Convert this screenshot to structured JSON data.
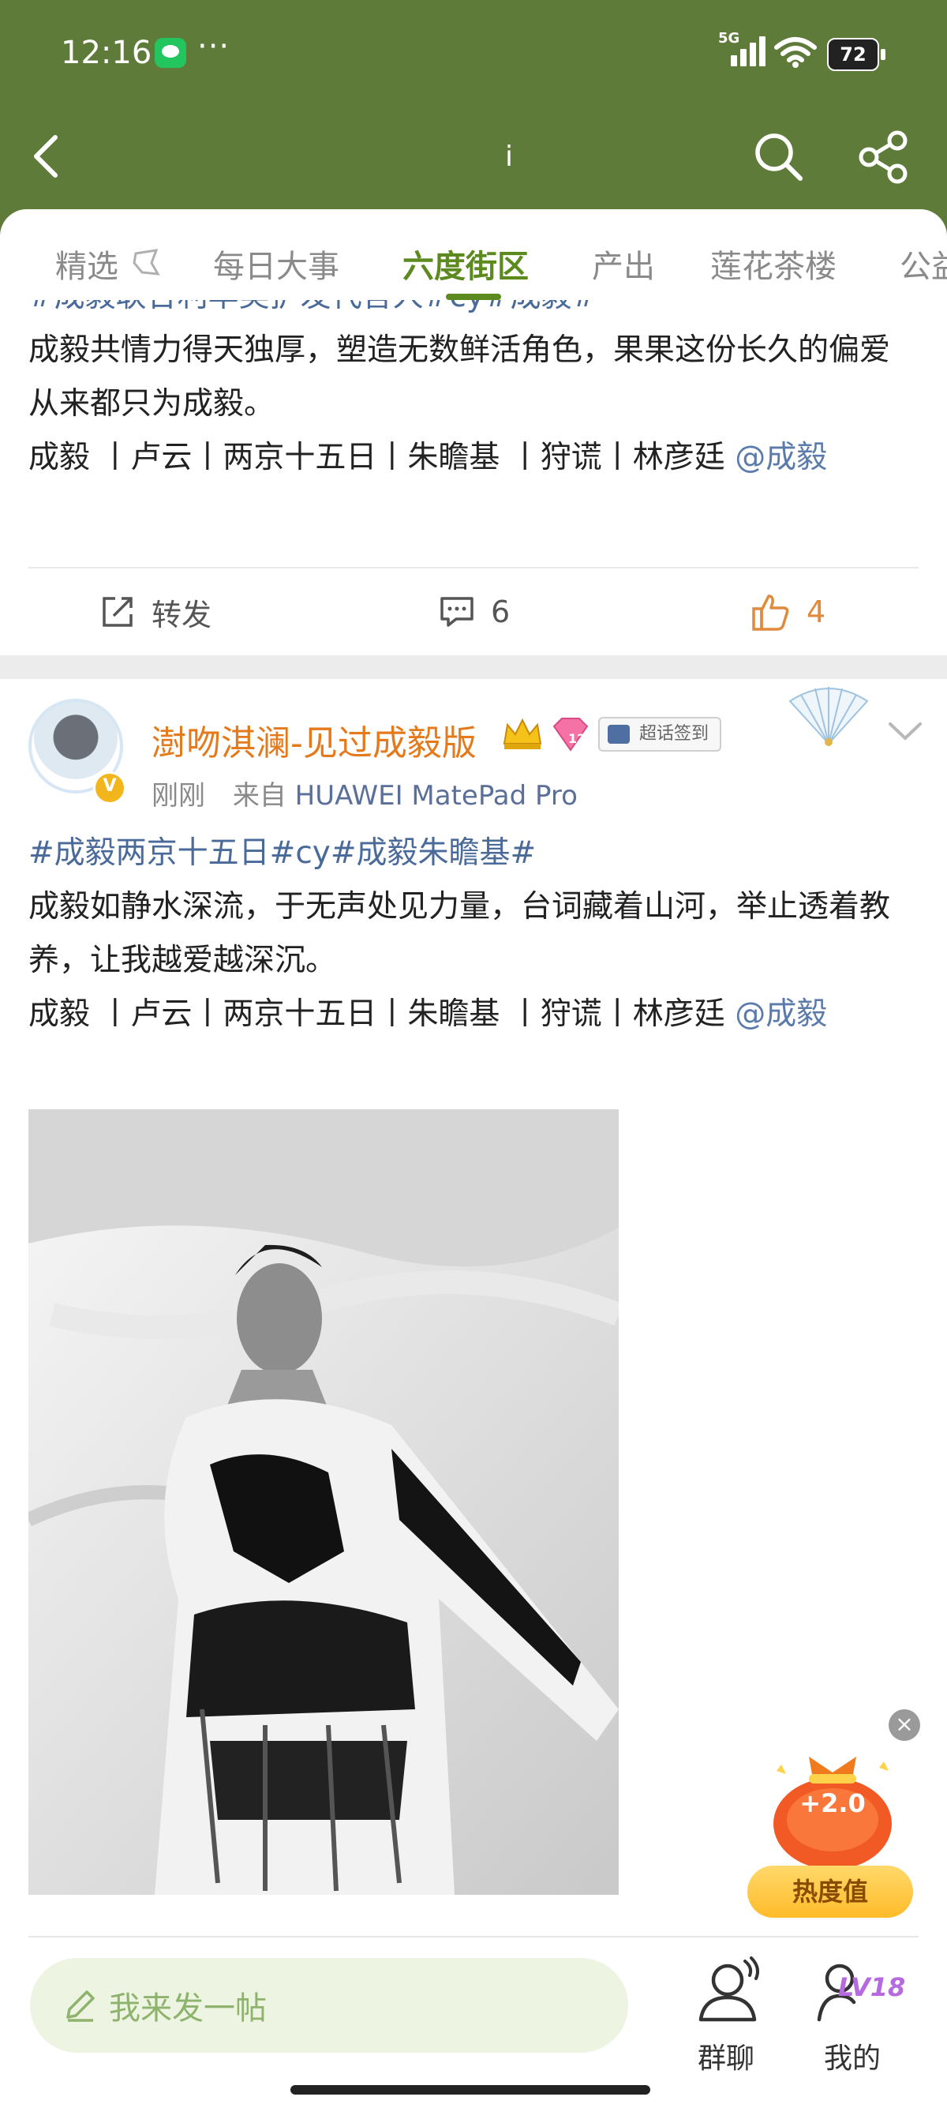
{
  "status_bar": {
    "time": "12:16",
    "more": "···",
    "network": "5G",
    "battery": "72"
  },
  "nav": {
    "center_mark": "i"
  },
  "tabs": [
    {
      "label": "精选"
    },
    {
      "label": "每日大事"
    },
    {
      "label": "六度街区",
      "active": true
    },
    {
      "label": "产出"
    },
    {
      "label": "莲花茶楼"
    },
    {
      "label": "公益"
    }
  ],
  "post1": {
    "hashtag_line": "#成毅联合利华美护发代言人#cy#成毅#",
    "body_line": "成毅共情力得天独厚，塑造无数鲜活角色，果果这份长久的偏爱从来都只为成毅。",
    "roles_line": "成毅 丨卢云丨两京十五日丨朱瞻基 丨狩谎丨林彦廷 ",
    "mention": "@成毅",
    "repost_label": "转发",
    "comment_count": "6",
    "like_count": "4"
  },
  "post2": {
    "username": "澍吻淇澜-见过成毅版",
    "level_badge": "12",
    "verified_badge": "V",
    "chaohua_badge": "超话签到",
    "time": "刚刚",
    "source_prefix": "来自",
    "source_device": "HUAWEI MatePad Pro",
    "hashtag_line": "#成毅两京十五日#cy#成毅朱瞻基#",
    "body_line": "成毅如静水深流，于无声处见力量，台词藏着山河，举止透着教养，让我越爱越深沉。",
    "roles_line": "成毅 丨卢云丨两京十五日丨朱瞻基 丨狩谎丨林彦廷 ",
    "mention": "@成毅"
  },
  "heat_widget": {
    "value": "+2.0",
    "label": "热度值",
    "close": "×"
  },
  "bottom_bar": {
    "compose_placeholder": "我来发一帖",
    "group_chat_label": "群聊",
    "profile_label": "我的",
    "level": "LV18"
  },
  "colors": {
    "header": "#5e7b39",
    "accent": "#5c8a1e",
    "username": "#e57a1c",
    "hashtag": "#4a6a9a",
    "like": "#e08a3c"
  }
}
